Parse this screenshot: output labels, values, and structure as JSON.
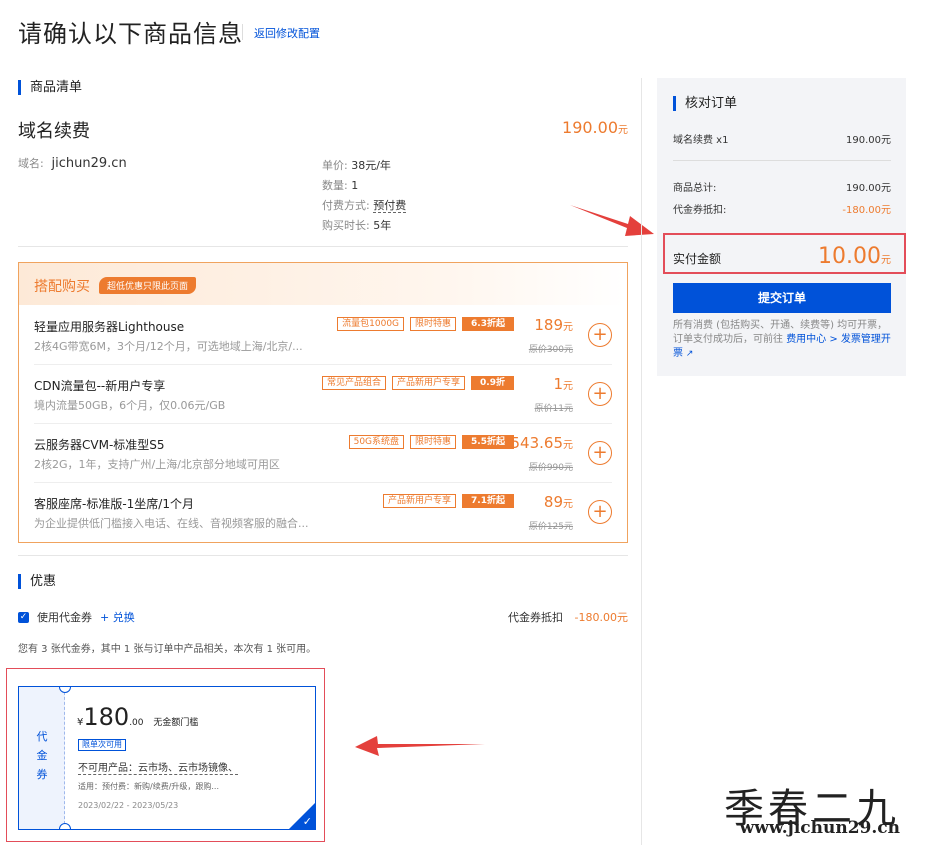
{
  "header": {
    "title": "请确认以下商品信息",
    "back_link": "返回修改配置"
  },
  "product_section": {
    "heading": "商品清单",
    "product_name": "域名续费",
    "price_value": "190.00",
    "price_unit": "元",
    "domain_label": "域名:",
    "domain_value": "jichun29.cn",
    "details": [
      {
        "label": "单价:",
        "value": "38元/年"
      },
      {
        "label": "数量:",
        "value": "1"
      },
      {
        "label": "付费方式:",
        "value": "预付费"
      },
      {
        "label": "购买时长:",
        "value": "5年"
      }
    ]
  },
  "bundle": {
    "title": "搭配购买",
    "tag": "超低优惠只限此页面",
    "items": [
      {
        "name": "轻量应用服务器Lighthouse",
        "desc": "2核4G带宽6M，3个月/12个月，可选地域上海/北京/...",
        "tags": [
          "流量包1000G",
          "限时特惠"
        ],
        "discount": "6.3折起",
        "price": "189",
        "unit": "元",
        "original": "原价300元"
      },
      {
        "name": "CDN流量包--新用户专享",
        "desc": "境内流量50GB，6个月，仅0.06元/GB",
        "tags": [
          "常见产品组合",
          "产品新用户专享"
        ],
        "discount": "0.9折",
        "price": "1",
        "unit": "元",
        "original": "原价11元"
      },
      {
        "name": "云服务器CVM-标准型S5",
        "desc": "2核2G，1年，支持广州/上海/北京部分地域可用区",
        "tags": [
          "50G系统盘",
          "限时特惠"
        ],
        "discount": "5.5折起",
        "price": "543.65",
        "unit": "元",
        "original": "原价990元"
      },
      {
        "name": "客服座席-标准版-1坐席/1个月",
        "desc": "为企业提供低门槛接入电话、在线、音视频客服的融合...",
        "tags": [
          "产品新用户专享"
        ],
        "discount": "7.1折起",
        "price": "89",
        "unit": "元",
        "original": "原价125元"
      }
    ]
  },
  "discount_section": {
    "heading": "优惠",
    "use_voucher": "使用代金券",
    "exchange": "+ 兑换",
    "deduct_label": "代金券抵扣",
    "deduct_value": "-180.00元",
    "info": "您有 3 张代金券，其中 1 张与订单中产品相关，本次有 1 张可用。"
  },
  "voucher": {
    "side": "代金券",
    "currency": "¥",
    "amount": "180",
    "cents": ".00",
    "threshold": "无金额门槛",
    "once_tag": "限单次可用",
    "exclude": "不可用产品：云市场、云市场镜像、",
    "scope": "适用：预付费：新购/续费/升级，跟购...",
    "dates": "2023/02/22 - 2023/05/23"
  },
  "summary": {
    "heading": "核对订单",
    "line_item": "域名续费 x1",
    "line_value": "190.00元",
    "subtotal_label": "商品总计:",
    "subtotal_value": "190.00元",
    "voucher_label": "代金券抵扣:",
    "voucher_value": "-180.00元",
    "final_label": "实付金额",
    "final_value": "10.00",
    "final_unit": "元",
    "submit": "提交订单",
    "note_prefix": "所有消费 (包括购买、开通、续费等) 均可开票，订单支付成功后，可前往 ",
    "note_link": "费用中心 > 发票管理开票"
  },
  "watermark": {
    "text": "季春二九",
    "url": "www.jichun29.cn"
  },
  "colors": {
    "primary": "#0052d9",
    "accent": "#ed7b2f",
    "highlight": "#e34d59"
  }
}
